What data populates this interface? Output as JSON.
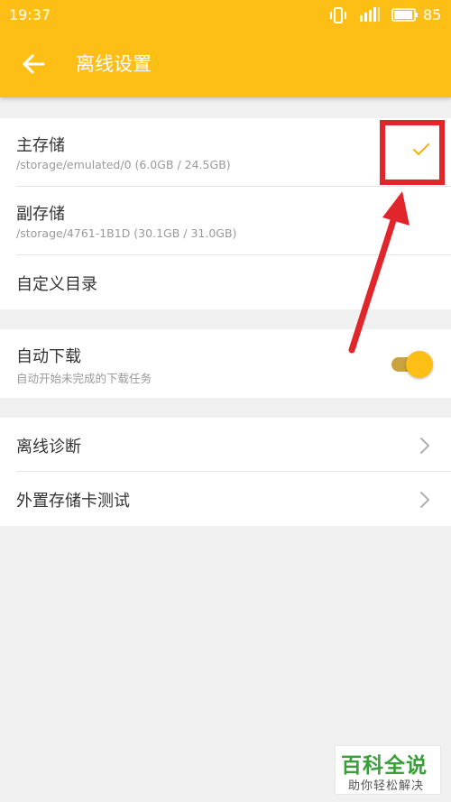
{
  "status_bar": {
    "time": "19:37",
    "battery_pct": "85",
    "icons": [
      "vibrate-icon",
      "signal-icon",
      "battery-icon"
    ]
  },
  "app_bar": {
    "title": "离线设置",
    "back_icon": "arrow-left-icon",
    "color": "#fdbf16"
  },
  "storage": {
    "primary": {
      "title": "主存储",
      "path": "/storage/emulated/0 (6.0GB / 24.5GB)",
      "selected": true,
      "check_color": "#f4b400"
    },
    "secondary": {
      "title": "副存储",
      "path": "/storage/4761-1B1D (30.1GB / 31.0GB)",
      "selected": false
    },
    "custom": {
      "title": "自定义目录"
    }
  },
  "auto_download": {
    "title": "自动下载",
    "subtitle": "自动开始未完成的下载任务",
    "enabled": true
  },
  "tools": {
    "diagnose": "离线诊断",
    "sdcard_test": "外置存储卡测试"
  },
  "annotation": {
    "color": "#e0262a"
  },
  "watermark": {
    "main": "百科全说",
    "sub": "助你轻松解决"
  }
}
